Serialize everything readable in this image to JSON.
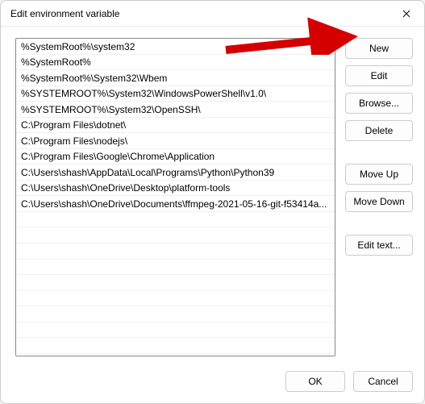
{
  "window": {
    "title": "Edit environment variable"
  },
  "list_items": [
    "%SystemRoot%\\system32",
    "%SystemRoot%",
    "%SystemRoot%\\System32\\Wbem",
    "%SYSTEMROOT%\\System32\\WindowsPowerShell\\v1.0\\",
    "%SYSTEMROOT%\\System32\\OpenSSH\\",
    "C:\\Program Files\\dotnet\\",
    "C:\\Program Files\\nodejs\\",
    "C:\\Program Files\\Google\\Chrome\\Application",
    "C:\\Users\\shash\\AppData\\Local\\Programs\\Python\\Python39",
    "C:\\Users\\shash\\OneDrive\\Desktop\\platform-tools",
    "C:\\Users\\shash\\OneDrive\\Documents\\ffmpeg-2021-05-16-git-f53414a..."
  ],
  "buttons": {
    "new": "New",
    "edit": "Edit",
    "browse": "Browse...",
    "delete": "Delete",
    "move_up": "Move Up",
    "move_down": "Move Down",
    "edit_text": "Edit text...",
    "ok": "OK",
    "cancel": "Cancel"
  },
  "annotation": {
    "arrow_target": "new-button"
  }
}
